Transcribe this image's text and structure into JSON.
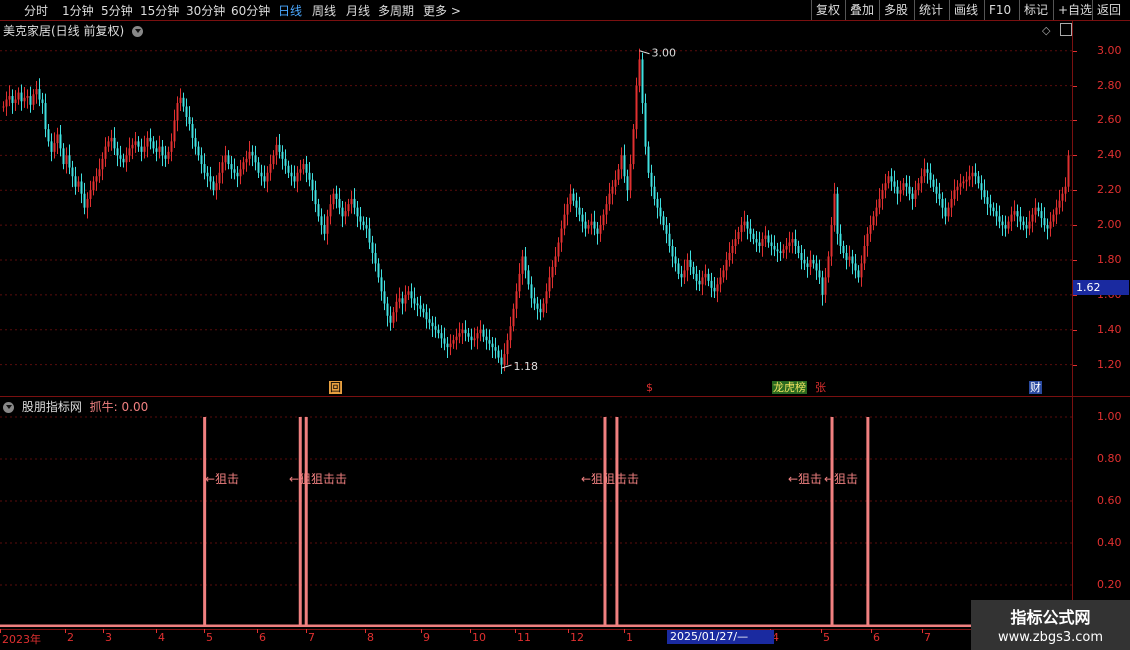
{
  "toolbar": {
    "timeframes": [
      "分时",
      "1分钟",
      "5分钟",
      "15分钟",
      "30分钟",
      "60分钟",
      "日线",
      "周线",
      "月线",
      "多周期",
      "更多 >"
    ],
    "active": "日线",
    "right_buttons": [
      "复权",
      "叠加",
      "多股",
      "统计",
      "画线",
      "F10",
      "标记",
      "+自选",
      "返回"
    ]
  },
  "main_panel": {
    "title": "美克家居(日线 前复权)",
    "y_labels": [
      "3.00",
      "2.80",
      "2.60",
      "2.40",
      "2.20",
      "2.00",
      "1.80",
      "1.60",
      "1.40",
      "1.20"
    ],
    "current_price": "1.62",
    "high_label": "3.00",
    "low_label": "1.18",
    "events": [
      {
        "text": "回",
        "color": "#e8a040"
      },
      {
        "text": "$",
        "color": "#e03030"
      },
      {
        "text": "龙虎榜",
        "color": "#e0c040"
      },
      {
        "text": "张",
        "color": "#e03030"
      },
      {
        "text": "财",
        "color": "#4aa8ff"
      }
    ]
  },
  "indicator_panel": {
    "title": "股朋指标网",
    "value_label": "抓牛: 0.00",
    "y_labels": [
      "1.00",
      "0.80",
      "0.60",
      "0.40",
      "0.20"
    ],
    "signal_label": "←狙击",
    "signal_label_double": "←狙狙击击"
  },
  "x_axis": {
    "labels": [
      "2023年",
      "2",
      "3",
      "4",
      "5",
      "6",
      "7",
      "8",
      "9",
      "10",
      "11",
      "12",
      "1",
      "4",
      "5",
      "6",
      "7"
    ],
    "cursor_date": "2025/01/27/—"
  },
  "watermark": {
    "line1": "指标公式网",
    "line2": "www.zbgs3.com"
  },
  "colors": {
    "up": "#e03030",
    "down": "#40e0e0",
    "grid": "#7a1010",
    "signal": "#f08080"
  },
  "chart_data": {
    "type": "candlestick",
    "y_range": [
      1.1,
      3.05
    ],
    "closes": [
      2.68,
      2.72,
      2.74,
      2.7,
      2.72,
      2.76,
      2.71,
      2.73,
      2.74,
      2.69,
      2.75,
      2.78,
      2.72,
      2.7,
      2.55,
      2.48,
      2.42,
      2.47,
      2.52,
      2.44,
      2.35,
      2.4,
      2.33,
      2.28,
      2.22,
      2.25,
      2.18,
      2.1,
      2.15,
      2.2,
      2.25,
      2.28,
      2.32,
      2.38,
      2.45,
      2.48,
      2.5,
      2.44,
      2.4,
      2.38,
      2.36,
      2.4,
      2.44,
      2.46,
      2.48,
      2.45,
      2.42,
      2.45,
      2.5,
      2.48,
      2.44,
      2.42,
      2.45,
      2.4,
      2.38,
      2.42,
      2.48,
      2.6,
      2.7,
      2.73,
      2.68,
      2.62,
      2.58,
      2.5,
      2.45,
      2.4,
      2.35,
      2.3,
      2.28,
      2.25,
      2.2,
      2.24,
      2.3,
      2.36,
      2.4,
      2.35,
      2.32,
      2.3,
      2.28,
      2.32,
      2.36,
      2.38,
      2.42,
      2.4,
      2.36,
      2.3,
      2.28,
      2.25,
      2.3,
      2.35,
      2.4,
      2.46,
      2.42,
      2.38,
      2.34,
      2.3,
      2.28,
      2.25,
      2.3,
      2.32,
      2.35,
      2.3,
      2.26,
      2.2,
      2.12,
      2.05,
      2.0,
      1.95,
      2.05,
      2.12,
      2.18,
      2.15,
      2.1,
      2.05,
      2.08,
      2.12,
      2.15,
      2.1,
      2.05,
      2.02,
      2.0,
      1.98,
      1.9,
      1.84,
      1.78,
      1.7,
      1.62,
      1.55,
      1.48,
      1.44,
      1.5,
      1.56,
      1.58,
      1.55,
      1.6,
      1.62,
      1.58,
      1.55,
      1.54,
      1.52,
      1.5,
      1.46,
      1.44,
      1.42,
      1.4,
      1.38,
      1.35,
      1.32,
      1.3,
      1.32,
      1.34,
      1.36,
      1.38,
      1.4,
      1.38,
      1.36,
      1.34,
      1.35,
      1.38,
      1.4,
      1.36,
      1.34,
      1.32,
      1.3,
      1.28,
      1.24,
      1.2,
      1.26,
      1.34,
      1.42,
      1.52,
      1.62,
      1.72,
      1.82,
      1.74,
      1.66,
      1.58,
      1.55,
      1.52,
      1.5,
      1.55,
      1.62,
      1.7,
      1.76,
      1.82,
      1.9,
      1.98,
      2.06,
      2.12,
      2.18,
      2.14,
      2.1,
      2.06,
      2.02,
      1.98,
      2.0,
      2.02,
      1.98,
      1.95,
      2.0,
      2.06,
      2.12,
      2.18,
      2.22,
      2.26,
      2.32,
      2.4,
      2.28,
      2.2,
      2.35,
      2.55,
      2.8,
      2.95,
      2.7,
      2.45,
      2.3,
      2.22,
      2.15,
      2.1,
      2.05,
      2.0,
      1.95,
      1.88,
      1.82,
      1.78,
      1.72,
      1.7,
      1.74,
      1.8,
      1.76,
      1.72,
      1.68,
      1.66,
      1.7,
      1.72,
      1.68,
      1.64,
      1.62,
      1.66,
      1.7,
      1.74,
      1.8,
      1.84,
      1.88,
      1.92,
      1.96,
      2.0,
      2.02,
      1.98,
      1.95,
      1.92,
      1.9,
      1.88,
      1.92,
      1.94,
      1.9,
      1.88,
      1.86,
      1.85,
      1.84,
      1.86,
      1.88,
      1.9,
      1.92,
      1.88,
      1.84,
      1.8,
      1.78,
      1.76,
      1.8,
      1.78,
      1.74,
      1.7,
      1.6,
      1.7,
      1.82,
      2.0,
      2.18,
      1.95,
      1.88,
      1.84,
      1.8,
      1.82,
      1.78,
      1.74,
      1.7,
      1.78,
      1.88,
      1.95,
      2.0,
      2.05,
      2.1,
      2.15,
      2.2,
      2.24,
      2.28,
      2.25,
      2.22,
      2.18,
      2.2,
      2.24,
      2.22,
      2.18,
      2.15,
      2.2,
      2.24,
      2.28,
      2.32,
      2.3,
      2.26,
      2.22,
      2.18,
      2.15,
      2.1,
      2.05,
      2.1,
      2.15,
      2.2,
      2.22,
      2.24,
      2.25,
      2.26,
      2.28,
      2.3,
      2.28,
      2.24,
      2.2,
      2.16,
      2.12,
      2.1,
      2.08,
      2.05,
      2.02,
      2.0,
      1.98,
      2.02,
      2.06,
      2.08,
      2.05,
      2.02,
      2.0,
      1.98,
      2.02,
      2.06,
      2.1,
      2.08,
      2.04,
      2.0,
      1.98,
      2.02,
      2.06,
      2.1,
      2.14,
      2.18,
      2.22,
      2.4
    ],
    "signals_x_px": [],
    "signal_bars": [
      0.17,
      0.25,
      0.255,
      0.505,
      0.515,
      0.695,
      0.725
    ],
    "signal_value": 1.0
  }
}
